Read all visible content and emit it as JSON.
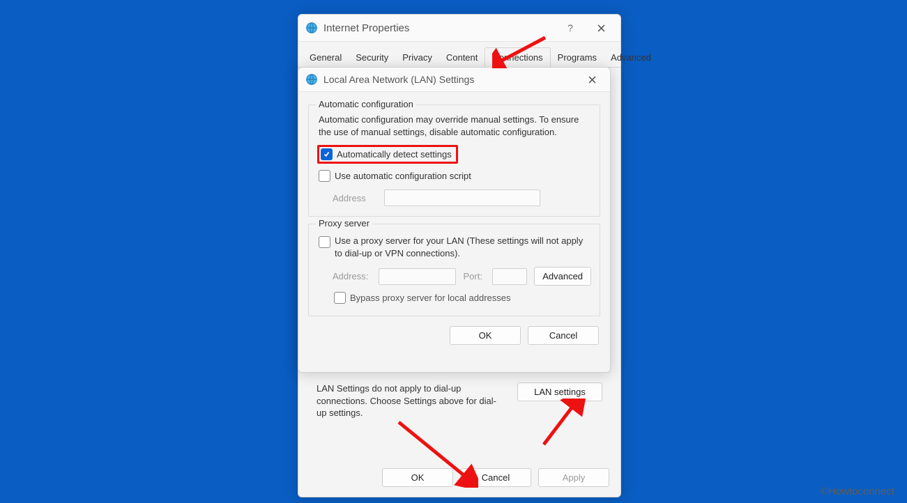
{
  "watermark": "©Howtoconnect",
  "parent": {
    "title": "Internet Properties",
    "help_tooltip": "?",
    "tabs": [
      "General",
      "Security",
      "Privacy",
      "Content",
      "Connections",
      "Programs",
      "Advanced"
    ],
    "active_tab_index": 4,
    "lan_note": "LAN Settings do not apply to dial-up connections. Choose Settings above for dial-up settings.",
    "lan_settings_btn": "LAN settings",
    "buttons": {
      "ok": "OK",
      "cancel": "Cancel",
      "apply": "Apply"
    }
  },
  "lan": {
    "title": "Local Area Network (LAN) Settings",
    "auto": {
      "legend": "Automatic configuration",
      "desc": "Automatic configuration may override manual settings.  To ensure the use of manual settings, disable automatic configuration.",
      "detect_label": "Automatically detect settings",
      "detect_checked": true,
      "script_label": "Use automatic configuration script",
      "script_checked": false,
      "address_label": "Address"
    },
    "proxy": {
      "legend": "Proxy server",
      "use_label": "Use a proxy server for your LAN (These settings will not apply to dial-up or VPN connections).",
      "use_checked": false,
      "address_label": "Address:",
      "port_label": "Port:",
      "advanced_btn": "Advanced",
      "bypass_label": "Bypass proxy server for local addresses",
      "bypass_checked": false
    },
    "buttons": {
      "ok": "OK",
      "cancel": "Cancel"
    }
  }
}
